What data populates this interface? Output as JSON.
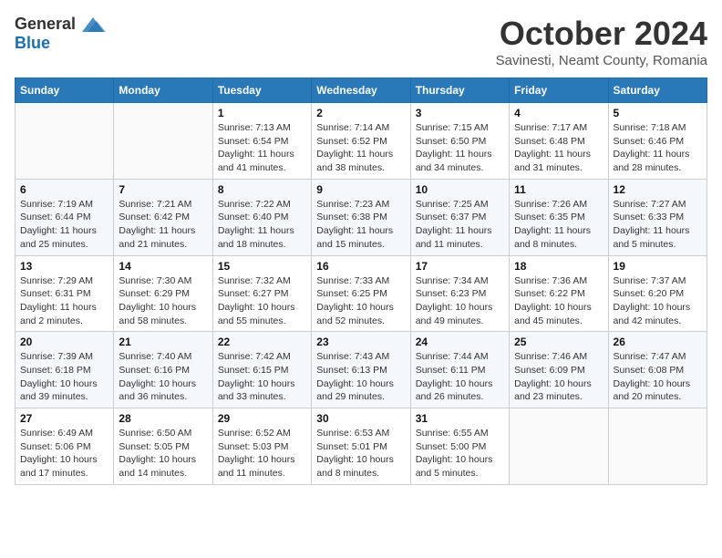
{
  "logo": {
    "general": "General",
    "blue": "Blue"
  },
  "title": "October 2024",
  "location": "Savinesti, Neamt County, Romania",
  "weekdays": [
    "Sunday",
    "Monday",
    "Tuesday",
    "Wednesday",
    "Thursday",
    "Friday",
    "Saturday"
  ],
  "weeks": [
    [
      {
        "day": "",
        "info": ""
      },
      {
        "day": "",
        "info": ""
      },
      {
        "day": "1",
        "info": "Sunrise: 7:13 AM\nSunset: 6:54 PM\nDaylight: 11 hours and 41 minutes."
      },
      {
        "day": "2",
        "info": "Sunrise: 7:14 AM\nSunset: 6:52 PM\nDaylight: 11 hours and 38 minutes."
      },
      {
        "day": "3",
        "info": "Sunrise: 7:15 AM\nSunset: 6:50 PM\nDaylight: 11 hours and 34 minutes."
      },
      {
        "day": "4",
        "info": "Sunrise: 7:17 AM\nSunset: 6:48 PM\nDaylight: 11 hours and 31 minutes."
      },
      {
        "day": "5",
        "info": "Sunrise: 7:18 AM\nSunset: 6:46 PM\nDaylight: 11 hours and 28 minutes."
      }
    ],
    [
      {
        "day": "6",
        "info": "Sunrise: 7:19 AM\nSunset: 6:44 PM\nDaylight: 11 hours and 25 minutes."
      },
      {
        "day": "7",
        "info": "Sunrise: 7:21 AM\nSunset: 6:42 PM\nDaylight: 11 hours and 21 minutes."
      },
      {
        "day": "8",
        "info": "Sunrise: 7:22 AM\nSunset: 6:40 PM\nDaylight: 11 hours and 18 minutes."
      },
      {
        "day": "9",
        "info": "Sunrise: 7:23 AM\nSunset: 6:38 PM\nDaylight: 11 hours and 15 minutes."
      },
      {
        "day": "10",
        "info": "Sunrise: 7:25 AM\nSunset: 6:37 PM\nDaylight: 11 hours and 11 minutes."
      },
      {
        "day": "11",
        "info": "Sunrise: 7:26 AM\nSunset: 6:35 PM\nDaylight: 11 hours and 8 minutes."
      },
      {
        "day": "12",
        "info": "Sunrise: 7:27 AM\nSunset: 6:33 PM\nDaylight: 11 hours and 5 minutes."
      }
    ],
    [
      {
        "day": "13",
        "info": "Sunrise: 7:29 AM\nSunset: 6:31 PM\nDaylight: 11 hours and 2 minutes."
      },
      {
        "day": "14",
        "info": "Sunrise: 7:30 AM\nSunset: 6:29 PM\nDaylight: 10 hours and 58 minutes."
      },
      {
        "day": "15",
        "info": "Sunrise: 7:32 AM\nSunset: 6:27 PM\nDaylight: 10 hours and 55 minutes."
      },
      {
        "day": "16",
        "info": "Sunrise: 7:33 AM\nSunset: 6:25 PM\nDaylight: 10 hours and 52 minutes."
      },
      {
        "day": "17",
        "info": "Sunrise: 7:34 AM\nSunset: 6:23 PM\nDaylight: 10 hours and 49 minutes."
      },
      {
        "day": "18",
        "info": "Sunrise: 7:36 AM\nSunset: 6:22 PM\nDaylight: 10 hours and 45 minutes."
      },
      {
        "day": "19",
        "info": "Sunrise: 7:37 AM\nSunset: 6:20 PM\nDaylight: 10 hours and 42 minutes."
      }
    ],
    [
      {
        "day": "20",
        "info": "Sunrise: 7:39 AM\nSunset: 6:18 PM\nDaylight: 10 hours and 39 minutes."
      },
      {
        "day": "21",
        "info": "Sunrise: 7:40 AM\nSunset: 6:16 PM\nDaylight: 10 hours and 36 minutes."
      },
      {
        "day": "22",
        "info": "Sunrise: 7:42 AM\nSunset: 6:15 PM\nDaylight: 10 hours and 33 minutes."
      },
      {
        "day": "23",
        "info": "Sunrise: 7:43 AM\nSunset: 6:13 PM\nDaylight: 10 hours and 29 minutes."
      },
      {
        "day": "24",
        "info": "Sunrise: 7:44 AM\nSunset: 6:11 PM\nDaylight: 10 hours and 26 minutes."
      },
      {
        "day": "25",
        "info": "Sunrise: 7:46 AM\nSunset: 6:09 PM\nDaylight: 10 hours and 23 minutes."
      },
      {
        "day": "26",
        "info": "Sunrise: 7:47 AM\nSunset: 6:08 PM\nDaylight: 10 hours and 20 minutes."
      }
    ],
    [
      {
        "day": "27",
        "info": "Sunrise: 6:49 AM\nSunset: 5:06 PM\nDaylight: 10 hours and 17 minutes."
      },
      {
        "day": "28",
        "info": "Sunrise: 6:50 AM\nSunset: 5:05 PM\nDaylight: 10 hours and 14 minutes."
      },
      {
        "day": "29",
        "info": "Sunrise: 6:52 AM\nSunset: 5:03 PM\nDaylight: 10 hours and 11 minutes."
      },
      {
        "day": "30",
        "info": "Sunrise: 6:53 AM\nSunset: 5:01 PM\nDaylight: 10 hours and 8 minutes."
      },
      {
        "day": "31",
        "info": "Sunrise: 6:55 AM\nSunset: 5:00 PM\nDaylight: 10 hours and 5 minutes."
      },
      {
        "day": "",
        "info": ""
      },
      {
        "day": "",
        "info": ""
      }
    ]
  ]
}
